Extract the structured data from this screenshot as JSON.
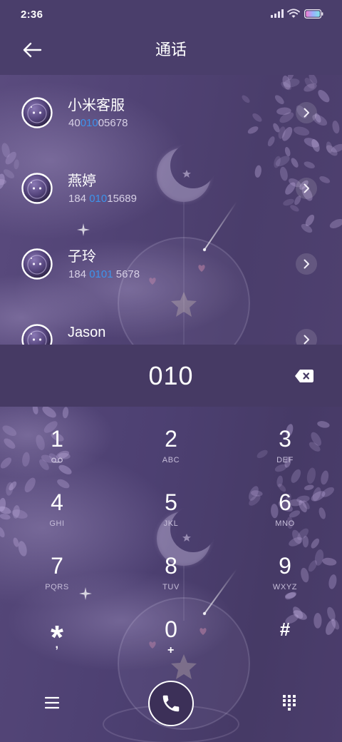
{
  "status_bar": {
    "time": "2:36",
    "icons": [
      "signal-icon",
      "wifi-icon",
      "battery-icon"
    ]
  },
  "header": {
    "title": "通话",
    "back_icon": "arrow-left-icon"
  },
  "contacts": [
    {
      "name": "小米客服",
      "number_parts": [
        {
          "text": "40",
          "highlight": false
        },
        {
          "text": "010",
          "highlight": true
        },
        {
          "text": "05678",
          "highlight": false
        }
      ],
      "avatar_icon": "avatar-icon",
      "action_icon": "chevron-right-icon"
    },
    {
      "name": "燕婷",
      "number_parts": [
        {
          "text": "184 ",
          "highlight": false
        },
        {
          "text": "010",
          "highlight": true
        },
        {
          "text": "15689",
          "highlight": false
        }
      ],
      "avatar_icon": "avatar-icon",
      "action_icon": "chevron-right-icon"
    },
    {
      "name": "子玲",
      "number_parts": [
        {
          "text": "184 ",
          "highlight": false
        },
        {
          "text": "0101",
          "highlight": true
        },
        {
          "text": " 5678",
          "highlight": false
        }
      ],
      "avatar_icon": "avatar-icon",
      "action_icon": "chevron-right-icon"
    },
    {
      "name": "Jason",
      "avatar_icon": "avatar-icon",
      "action_icon": "chevron-right-icon"
    }
  ],
  "dialer": {
    "input": "010",
    "backspace_icon": "backspace-icon",
    "keys": [
      {
        "digit": "1",
        "letters": "",
        "icon": "voicemail-icon"
      },
      {
        "digit": "2",
        "letters": "ABC"
      },
      {
        "digit": "3",
        "letters": "DEF"
      },
      {
        "digit": "4",
        "letters": "GHI"
      },
      {
        "digit": "5",
        "letters": "JKL"
      },
      {
        "digit": "6",
        "letters": "MNO"
      },
      {
        "digit": "7",
        "letters": "PQRS"
      },
      {
        "digit": "8",
        "letters": "TUV"
      },
      {
        "digit": "9",
        "letters": "WXYZ"
      },
      {
        "digit": "*",
        "letters": ","
      },
      {
        "digit": "0",
        "letters": "+"
      },
      {
        "digit": "#",
        "letters": ""
      }
    ]
  },
  "bottom_bar": {
    "menu_icon": "menu-icon",
    "call_icon": "phone-icon",
    "dialpad_icon": "dialpad-icon"
  },
  "colors": {
    "background": "#473b66",
    "header_background": "#4a3e6b",
    "dial_band": "#463a64",
    "text_primary": "#ffffff",
    "text_secondary": "#d7d0e6",
    "match_highlight": "#3d93ec",
    "key_letters": "#c6bdd9",
    "call_button": "#3c3058"
  }
}
